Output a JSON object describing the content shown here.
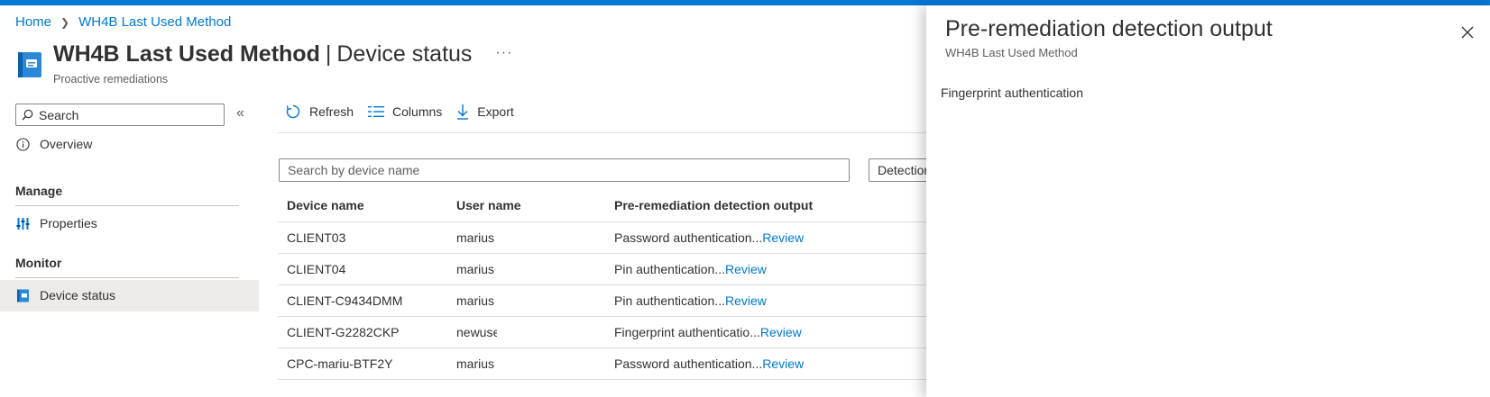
{
  "breadcrumb": {
    "home": "Home",
    "current": "WH4B Last Used Method"
  },
  "header": {
    "title": "WH4B Last Used Method",
    "separator": "|",
    "section": "Device status",
    "more": "···",
    "subtitle": "Proactive remediations"
  },
  "sidebar": {
    "search_placeholder": "Search",
    "collapse": "«",
    "overview": "Overview",
    "manage_heading": "Manage",
    "properties": "Properties",
    "monitor_heading": "Monitor",
    "device_status": "Device status"
  },
  "toolbar": {
    "refresh": "Refresh",
    "columns": "Columns",
    "export": "Export"
  },
  "filters": {
    "search_placeholder": "Search by device name",
    "detection_filter": "Detection"
  },
  "table": {
    "headers": [
      "Device name",
      "User name",
      "Pre-remediation detection output"
    ],
    "review_label": "Review",
    "rows": [
      {
        "device": "CLIENT03",
        "user": "marius",
        "output": "Password authentication..."
      },
      {
        "device": "CLIENT04",
        "user": "marius",
        "output": "Pin authentication..."
      },
      {
        "device": "CLIENT-C9434DMM",
        "user": "marius",
        "output": "Pin authentication..."
      },
      {
        "device": "CLIENT-G2282CKP",
        "user": "newuse",
        "output": "Fingerprint authenticatio..."
      },
      {
        "device": "CPC-mariu-BTF2Y",
        "user": "marius",
        "output": "Password authentication..."
      }
    ]
  },
  "panel": {
    "title": "Pre-remediation detection output",
    "subtitle": "WH4B Last Used Method",
    "body": "Fingerprint authentication"
  },
  "colors": {
    "accent": "#0078d4",
    "active_nav": "#edebe9"
  }
}
